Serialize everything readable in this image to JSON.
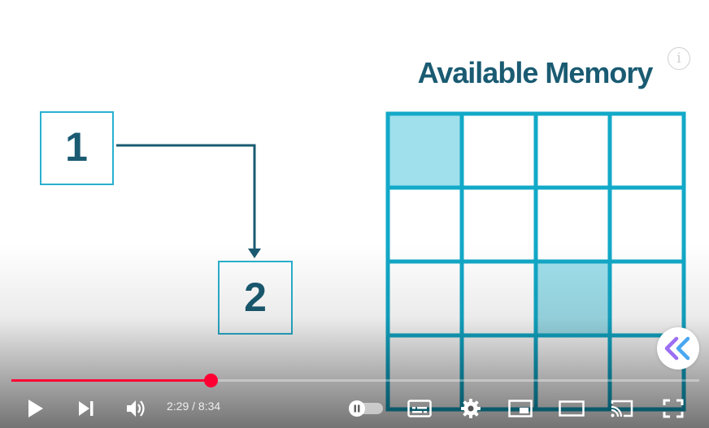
{
  "video": {
    "heading": "Available Memory",
    "box1_label": "1",
    "box2_label": "2",
    "grid": {
      "rows": 4,
      "cols": 4,
      "highlighted_cells": [
        [
          0,
          0
        ],
        [
          2,
          2
        ]
      ]
    },
    "colors": {
      "heading": "#1a5b72",
      "box_border": "#29b0cf",
      "box_text": "#1a5b72",
      "arrow": "#1a5b72",
      "grid_line": "#13a9c8",
      "cell_highlight": "#9fe0ec",
      "collapse_icon": "#9b6ef3"
    }
  },
  "player": {
    "current_time": "2:29",
    "separator": " / ",
    "duration": "8:34",
    "progress_fraction": 0.29,
    "progress_color": "#ff0033",
    "icons": {
      "play": "play-icon",
      "next": "next-icon",
      "volume": "volume-icon",
      "autoplay": "autoplay-toggle",
      "subtitles": "subtitles-icon",
      "settings": "gear-icon",
      "miniplayer": "miniplayer-icon",
      "theater": "theater-icon",
      "cast": "cast-icon",
      "fullscreen": "fullscreen-icon",
      "info": "info-icon",
      "collapse": "double-chevron-left-icon"
    }
  }
}
